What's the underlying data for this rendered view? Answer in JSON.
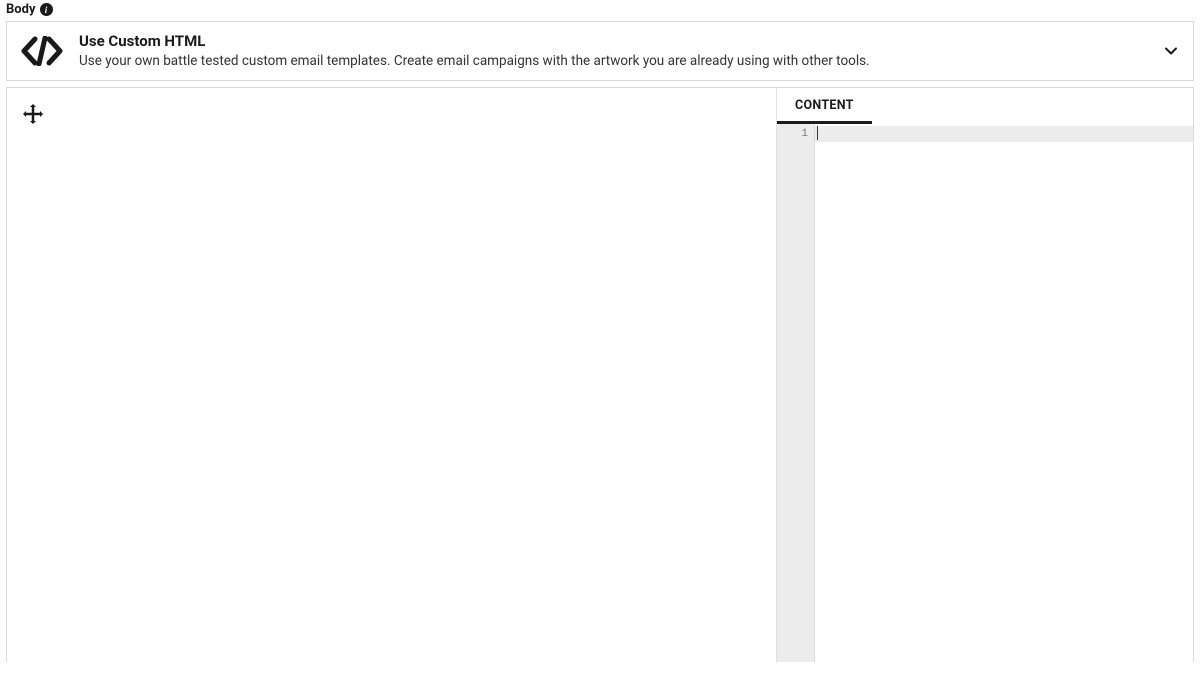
{
  "section": {
    "label": "Body"
  },
  "card": {
    "title": "Use Custom HTML",
    "description": "Use your own battle tested custom email templates. Create email campaigns with the artwork you are already using with other tools."
  },
  "panel": {
    "tab_label": "CONTENT",
    "line_number": "1"
  }
}
